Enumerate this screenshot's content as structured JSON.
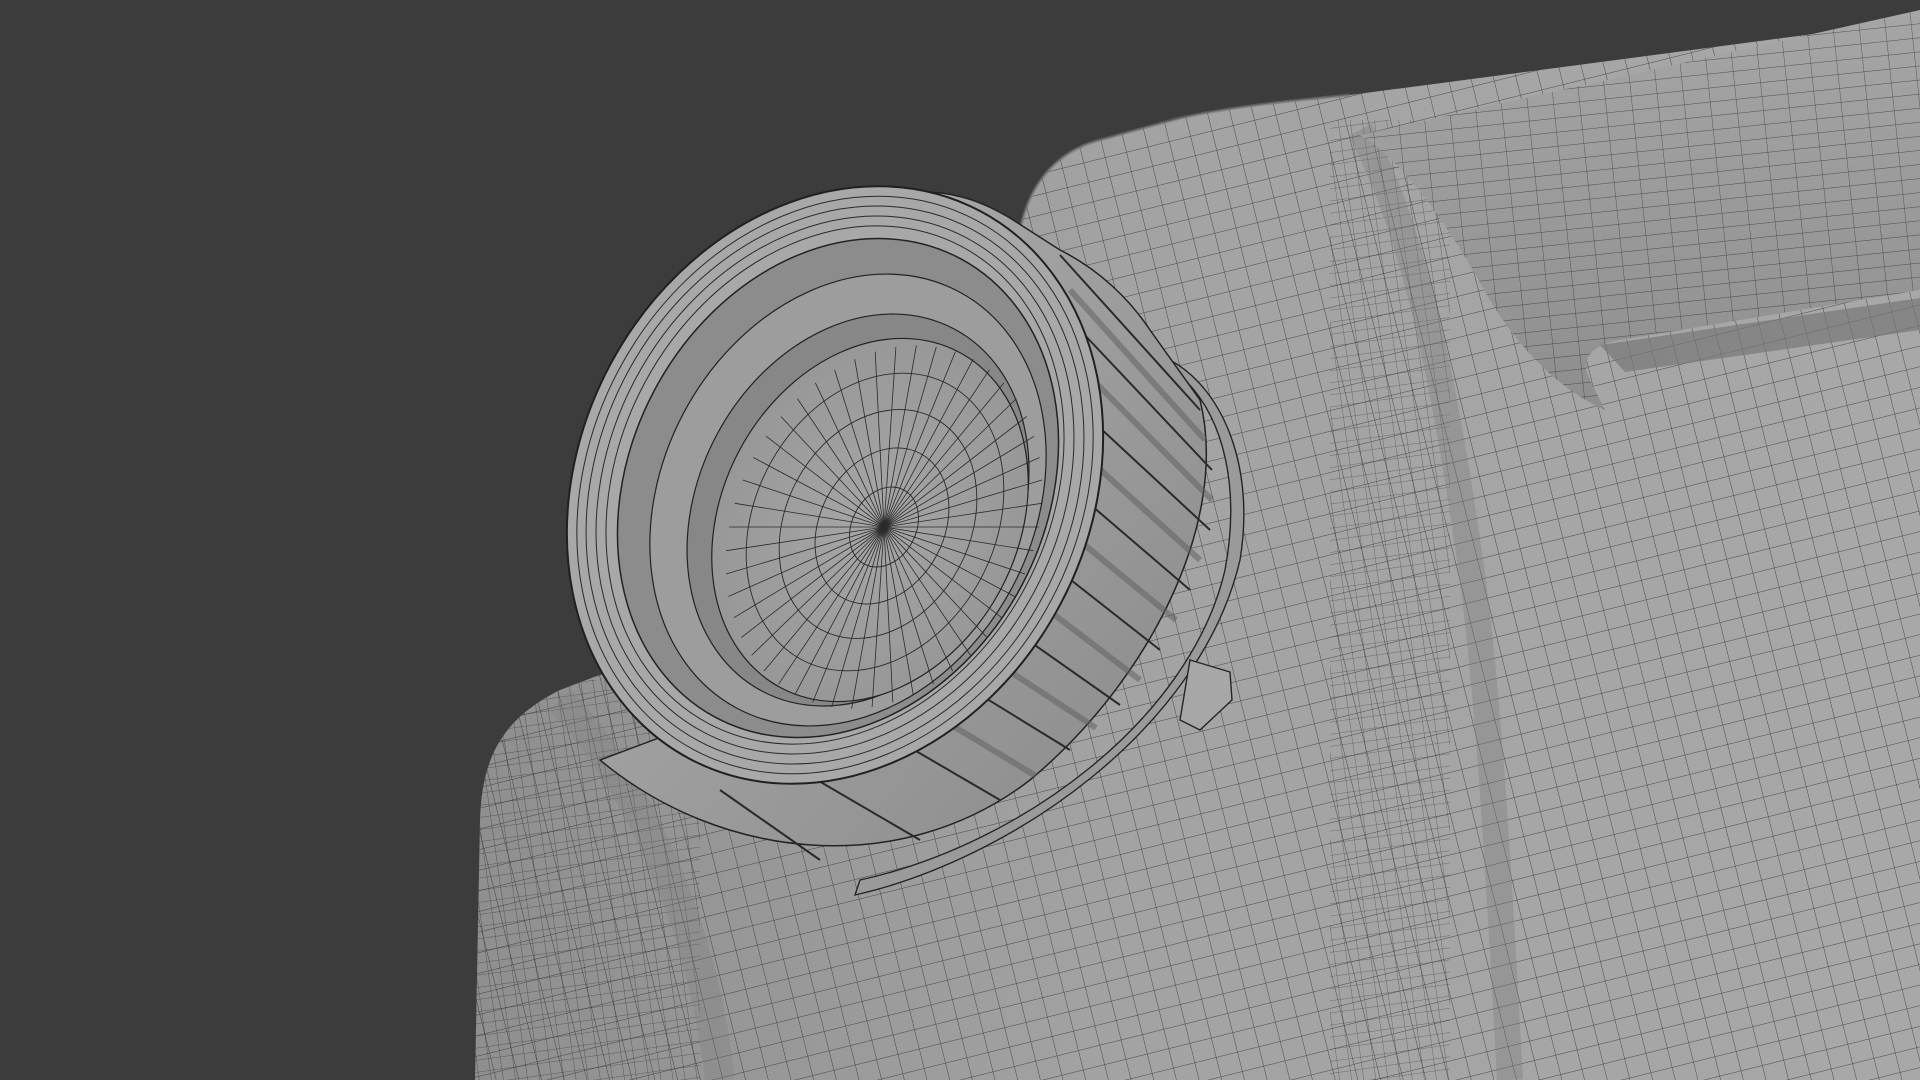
{
  "viewport": {
    "background": "#3c3c3c",
    "object": "jerrycan-wireframe-mesh",
    "surface_color": "#9c9c9c",
    "wire_color": "#1e1e1e",
    "cap_color": "#a3a3a3"
  }
}
